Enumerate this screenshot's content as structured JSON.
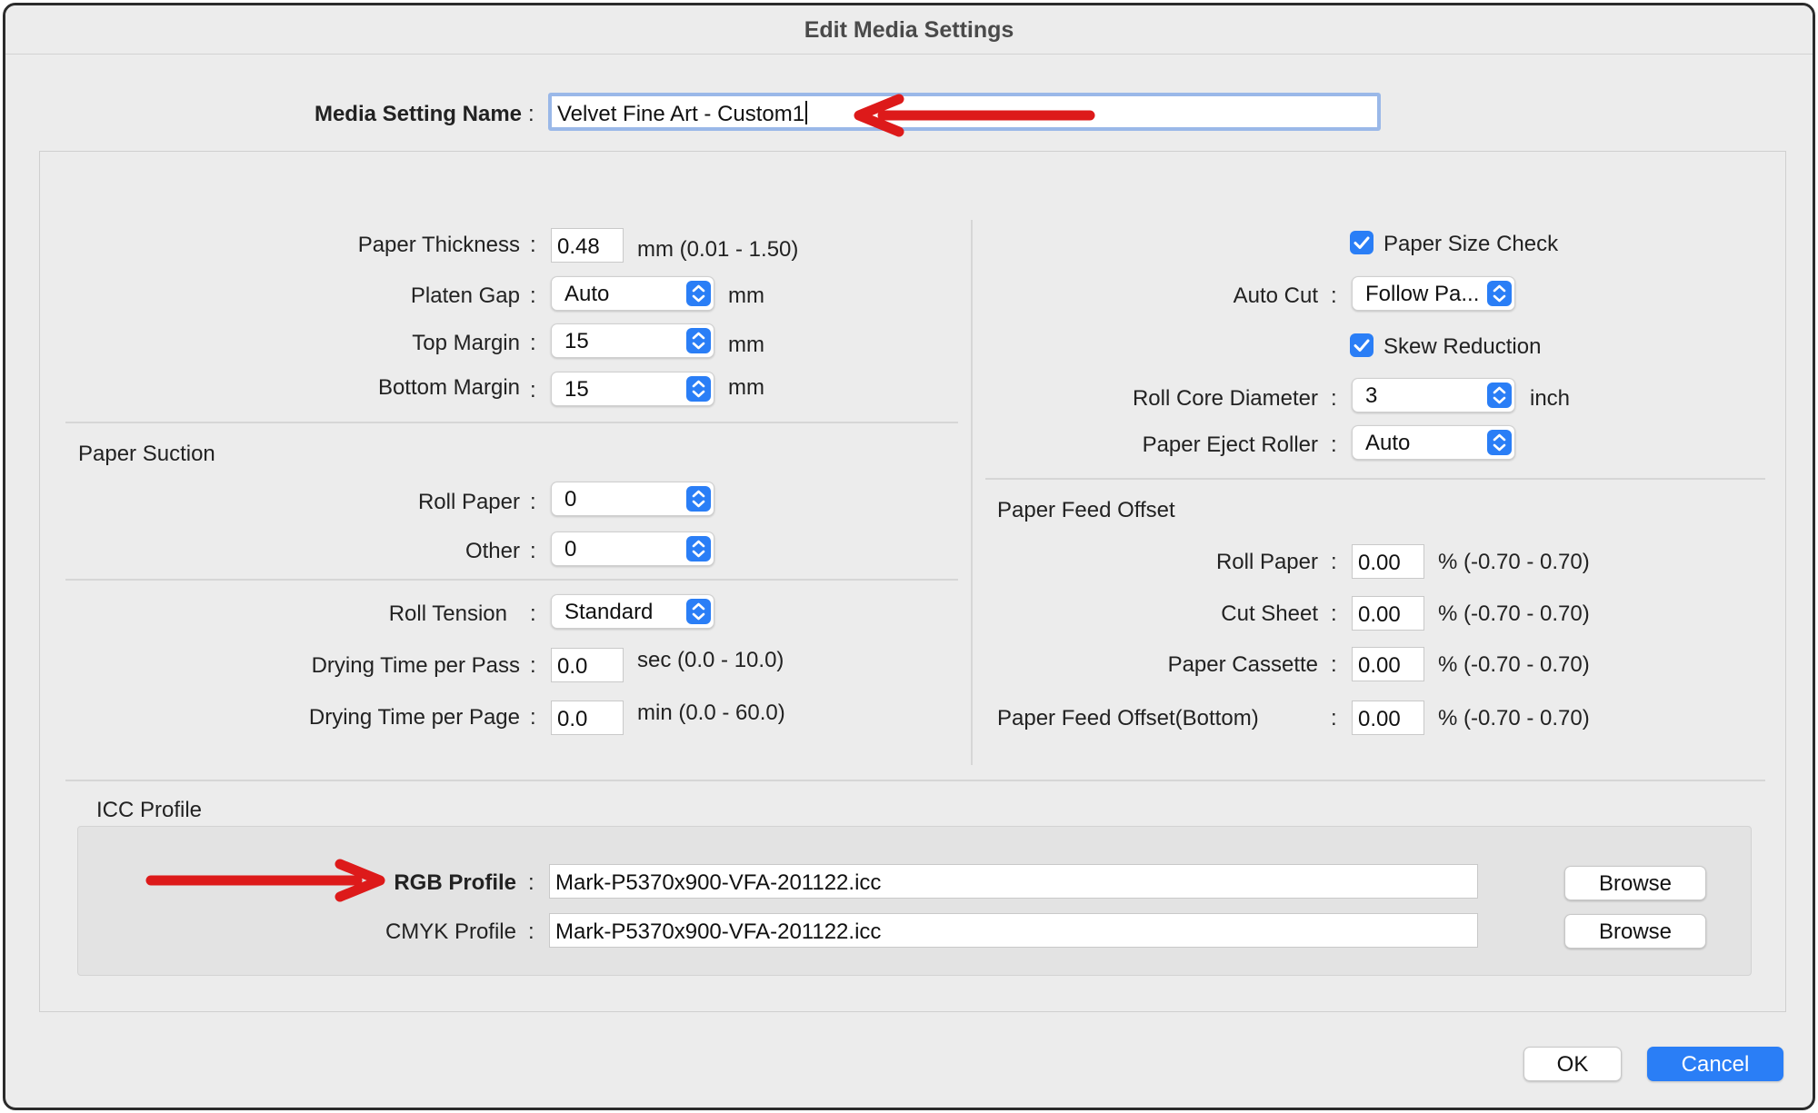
{
  "window": {
    "title": "Edit Media Settings"
  },
  "media_name": {
    "label": "Media Setting Name",
    "value": "Velvet Fine Art - Custom1"
  },
  "left": {
    "paper_thickness": {
      "label": "Paper Thickness",
      "value": "0.48",
      "unit": "mm (0.01 - 1.50)"
    },
    "platen_gap": {
      "label": "Platen Gap",
      "value": "Auto",
      "unit": "mm"
    },
    "top_margin": {
      "label": "Top Margin",
      "value": "15",
      "unit": "mm"
    },
    "bottom_margin": {
      "label": "Bottom Margin",
      "value": "15",
      "unit": "mm"
    },
    "paper_suction": {
      "title": "Paper Suction",
      "roll_paper": {
        "label": "Roll Paper",
        "value": "0"
      },
      "other": {
        "label": "Other",
        "value": "0"
      }
    },
    "roll_tension": {
      "label": "Roll Tension",
      "value": "Standard"
    },
    "drying_pass": {
      "label": "Drying Time per Pass",
      "value": "0.0",
      "unit": "sec (0.0 - 10.0)"
    },
    "drying_page": {
      "label": "Drying Time per Page",
      "value": "0.0",
      "unit": "min (0.0 - 60.0)"
    }
  },
  "right": {
    "paper_size_check": {
      "label": "Paper Size Check",
      "checked": true
    },
    "auto_cut": {
      "label": "Auto Cut",
      "value": "Follow Pa..."
    },
    "skew_reduction": {
      "label": "Skew Reduction",
      "checked": true
    },
    "roll_core_diameter": {
      "label": "Roll Core Diameter",
      "value": "3",
      "unit": "inch"
    },
    "paper_eject_roller": {
      "label": "Paper Eject Roller",
      "value": "Auto"
    },
    "paper_feed_offset": {
      "title": "Paper Feed Offset",
      "roll_paper": {
        "label": "Roll Paper",
        "value": "0.00",
        "unit": "% (-0.70 - 0.70)"
      },
      "cut_sheet": {
        "label": "Cut Sheet",
        "value": "0.00",
        "unit": "% (-0.70 - 0.70)"
      },
      "paper_cassette": {
        "label": "Paper Cassette",
        "value": "0.00",
        "unit": "% (-0.70 - 0.70)"
      },
      "bottom": {
        "label": "Paper Feed Offset(Bottom)",
        "value": "0.00",
        "unit": "% (-0.70 - 0.70)"
      }
    }
  },
  "icc": {
    "title": "ICC Profile",
    "rgb": {
      "label": "RGB Profile",
      "value": "Mark-P5370x900-VFA-201122.icc",
      "button": "Browse"
    },
    "cmyk": {
      "label": "CMYK Profile",
      "value": "Mark-P5370x900-VFA-201122.icc",
      "button": "Browse"
    }
  },
  "footer": {
    "ok": "OK",
    "cancel": "Cancel"
  },
  "colors": {
    "accent": "#2a7ef6",
    "annotation_arrow": "#dd1a1a",
    "focus_ring": "#9ab8e8"
  },
  "icons": {
    "stepper": "up-down-chevron",
    "checkbox": "checkmark",
    "annotation": "red-arrow"
  }
}
